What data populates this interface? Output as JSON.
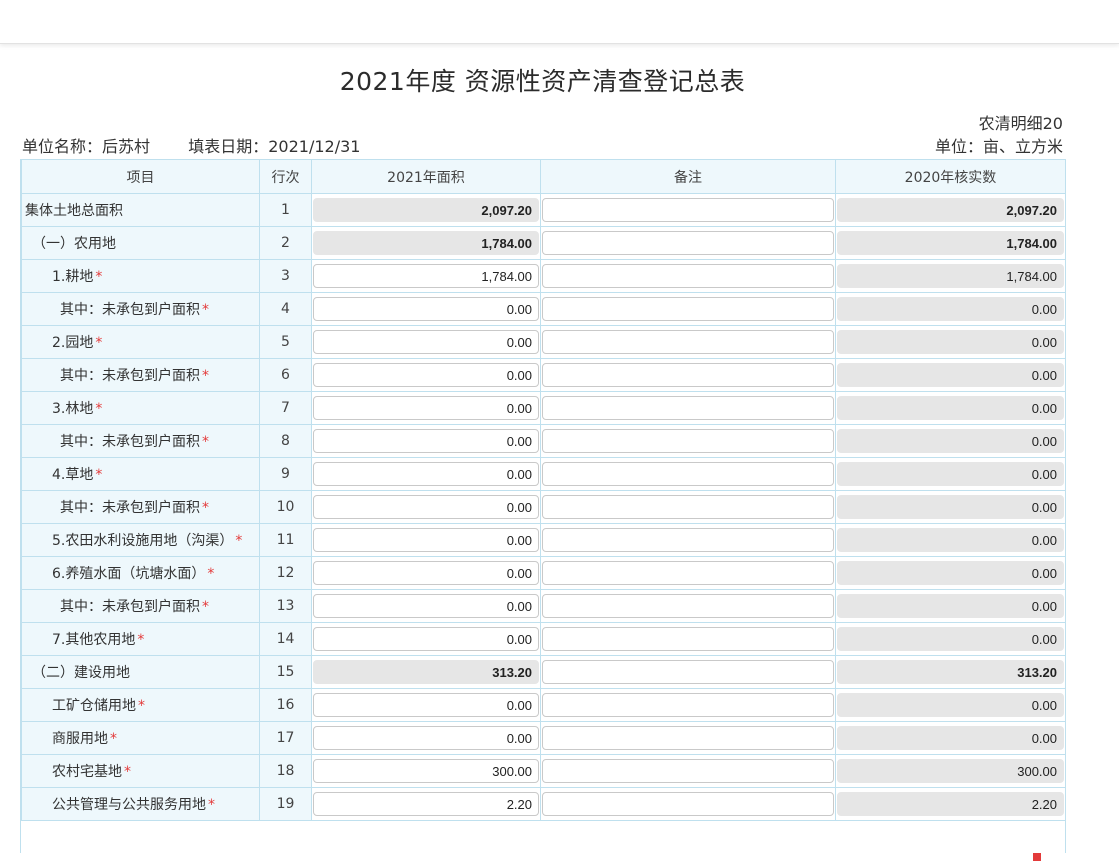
{
  "title": "2021年度 资源性资产清查登记总表",
  "form_code": "农清明细20",
  "meta": {
    "unit_name_label": "单位名称：",
    "unit_name": "后苏村",
    "fill_date_label": "填表日期：",
    "fill_date": "2021/12/31",
    "unit_label": "单位：亩、立方米"
  },
  "headers": {
    "item": "项目",
    "row_no": "行次",
    "area_2021": "2021年面积",
    "note": "备注",
    "verified_2020": "2020年核实数"
  },
  "rows": [
    {
      "item": "集体土地总面积",
      "row": "1",
      "area": "2,097.20",
      "verified": "2,097.20",
      "indent": 0,
      "star": false,
      "bold": true,
      "editable": false
    },
    {
      "item": "（一）农用地",
      "row": "2",
      "area": "1,784.00",
      "verified": "1,784.00",
      "indent": 1,
      "star": false,
      "bold": true,
      "editable": false
    },
    {
      "item": "1.耕地",
      "row": "3",
      "area": "1,784.00",
      "verified": "1,784.00",
      "indent": 2,
      "star": true,
      "bold": false,
      "editable": true
    },
    {
      "item": "其中：未承包到户面积",
      "row": "4",
      "area": "0.00",
      "verified": "0.00",
      "indent": 3,
      "star": true,
      "bold": false,
      "editable": true
    },
    {
      "item": "2.园地",
      "row": "5",
      "area": "0.00",
      "verified": "0.00",
      "indent": 2,
      "star": true,
      "bold": false,
      "editable": true
    },
    {
      "item": "其中：未承包到户面积",
      "row": "6",
      "area": "0.00",
      "verified": "0.00",
      "indent": 3,
      "star": true,
      "bold": false,
      "editable": true
    },
    {
      "item": "3.林地",
      "row": "7",
      "area": "0.00",
      "verified": "0.00",
      "indent": 2,
      "star": true,
      "bold": false,
      "editable": true
    },
    {
      "item": "其中：未承包到户面积",
      "row": "8",
      "area": "0.00",
      "verified": "0.00",
      "indent": 3,
      "star": true,
      "bold": false,
      "editable": true
    },
    {
      "item": "4.草地",
      "row": "9",
      "area": "0.00",
      "verified": "0.00",
      "indent": 2,
      "star": true,
      "bold": false,
      "editable": true
    },
    {
      "item": "其中：未承包到户面积",
      "row": "10",
      "area": "0.00",
      "verified": "0.00",
      "indent": 3,
      "star": true,
      "bold": false,
      "editable": true
    },
    {
      "item": "5.农田水利设施用地（沟渠）",
      "row": "11",
      "area": "0.00",
      "verified": "0.00",
      "indent": 2,
      "star": true,
      "bold": false,
      "editable": true
    },
    {
      "item": "6.养殖水面（坑塘水面）",
      "row": "12",
      "area": "0.00",
      "verified": "0.00",
      "indent": 2,
      "star": true,
      "bold": false,
      "editable": true
    },
    {
      "item": "其中：未承包到户面积",
      "row": "13",
      "area": "0.00",
      "verified": "0.00",
      "indent": 3,
      "star": true,
      "bold": false,
      "editable": true
    },
    {
      "item": "7.其他农用地",
      "row": "14",
      "area": "0.00",
      "verified": "0.00",
      "indent": 2,
      "star": true,
      "bold": false,
      "editable": true
    },
    {
      "item": "（二）建设用地",
      "row": "15",
      "area": "313.20",
      "verified": "313.20",
      "indent": 1,
      "star": false,
      "bold": true,
      "editable": false
    },
    {
      "item": "工矿仓储用地",
      "row": "16",
      "area": "0.00",
      "verified": "0.00",
      "indent": 2,
      "star": true,
      "bold": false,
      "editable": true
    },
    {
      "item": "商服用地",
      "row": "17",
      "area": "0.00",
      "verified": "0.00",
      "indent": 2,
      "star": true,
      "bold": false,
      "editable": true
    },
    {
      "item": "农村宅基地",
      "row": "18",
      "area": "300.00",
      "verified": "300.00",
      "indent": 2,
      "star": true,
      "bold": false,
      "editable": true
    },
    {
      "item": "公共管理与公共服务用地",
      "row": "19",
      "area": "2.20",
      "verified": "2.20",
      "indent": 2,
      "star": true,
      "bold": false,
      "editable": true
    }
  ],
  "colors": {
    "header_bg": "#eef8fc",
    "border": "#bfe0ee",
    "readonly_bg": "#e6e6e6",
    "required_star": "#e33a3a"
  }
}
